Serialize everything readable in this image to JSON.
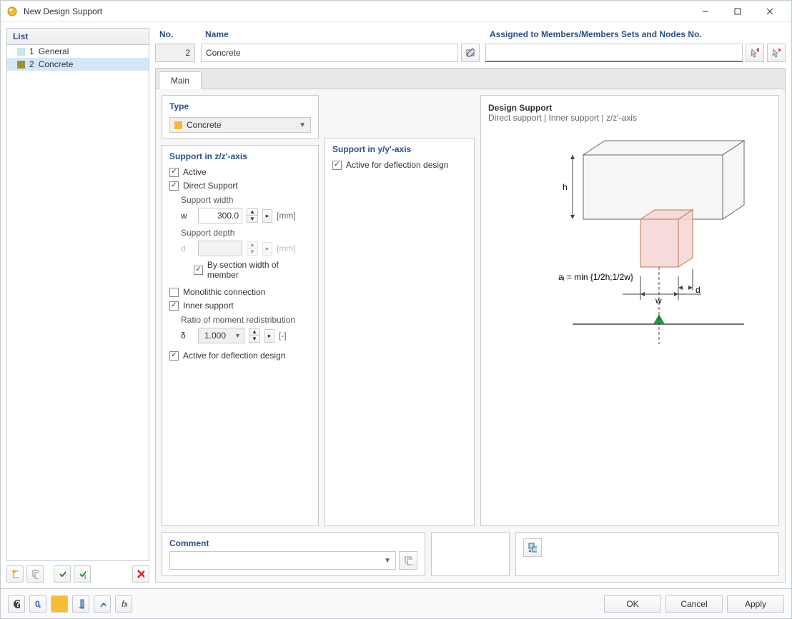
{
  "window": {
    "title": "New Design Support"
  },
  "list": {
    "header": "List",
    "items": [
      {
        "num": "1",
        "label": "General",
        "color": "#bfe8ec"
      },
      {
        "num": "2",
        "label": "Concrete",
        "color": "#97943a"
      }
    ]
  },
  "no": {
    "label": "No.",
    "value": "2"
  },
  "name": {
    "label": "Name",
    "value": "Concrete"
  },
  "assigned": {
    "label": "Assigned to Members/Members Sets and Nodes No."
  },
  "tabs": {
    "main": "Main"
  },
  "type": {
    "header": "Type",
    "value": "Concrete",
    "color": "#f4bd34"
  },
  "support_z": {
    "header": "Support in z/z'-axis",
    "active": "Active",
    "direct": "Direct Support",
    "width_label": "Support width",
    "width_var": "w",
    "width_val": "300.0",
    "width_unit": "[mm]",
    "depth_label": "Support depth",
    "depth_var": "d",
    "depth_unit": "[mm]",
    "by_section": "By section width of member",
    "monolithic": "Monolithic connection",
    "inner": "Inner support",
    "ratio_label": "Ratio of moment redistribution",
    "ratio_var": "δ",
    "ratio_val": "1.000",
    "ratio_unit": "[-]",
    "deflection": "Active for deflection design"
  },
  "support_y": {
    "header": "Support in y/y'-axis",
    "deflection": "Active for deflection design"
  },
  "diagram": {
    "title": "Design Support",
    "subtitle": "Direct support | Inner support | z/z'-axis",
    "h": "h",
    "w": "w",
    "d": "d",
    "formula": "aᵢ = min {1/2h;1/2w}"
  },
  "comment": {
    "header": "Comment"
  },
  "buttons": {
    "ok": "OK",
    "cancel": "Cancel",
    "apply": "Apply"
  }
}
